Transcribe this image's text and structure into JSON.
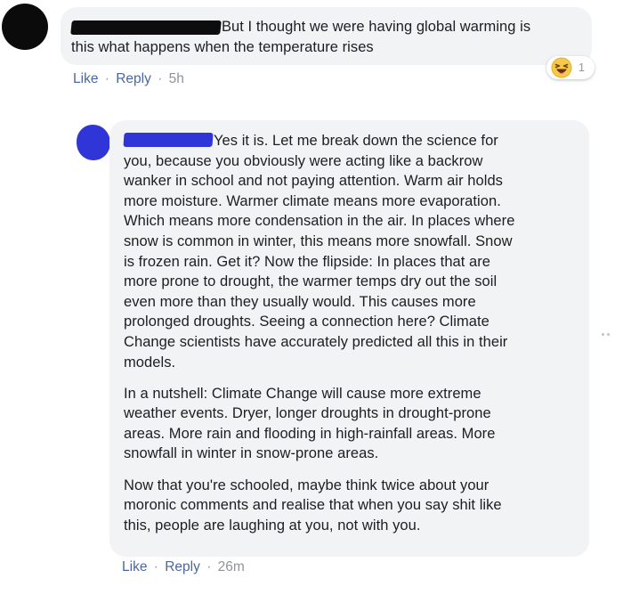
{
  "comment": {
    "text_lines": [
      "But I thought we were having global warming is",
      "this what happens when the temperature rises"
    ],
    "actions": {
      "like": "Like",
      "reply": "Reply",
      "separator": "·",
      "time": "5h"
    },
    "reaction": {
      "icon": "haha-emoji-icon",
      "count": "1"
    }
  },
  "reply": {
    "paragraphs": [
      [
        "Yes it is. Let me break down the science for",
        "you, because you obviously were acting like a backrow",
        "wanker in school and not paying attention. Warm air holds",
        "more moisture. Warmer climate means more evaporation.",
        "Which means more condensation in the air. In places where",
        "snow is common in winter, this means more snowfall. Snow",
        "is frozen rain. Get it? Now the flipside: In places that are",
        "more prone to drought, the warmer temps dry out the soil",
        "even more than they usually would. This causes more",
        "prolonged droughts. Seeing a connection here? Climate",
        "Change scientists have accurately predicted all this in their",
        "models."
      ],
      [
        "In a nutshell: Climate Change will cause more extreme",
        "weather events. Dryer, longer droughts in drought-prone",
        "areas. More rain and flooding in high-rainfall areas. More",
        "snowfall in winter in snow-prone areas."
      ],
      [
        "Now that you're schooled, maybe think twice about your",
        "moronic comments and realise that when you say shit like",
        "this, people are laughing at you, not with you."
      ]
    ],
    "actions": {
      "like": "Like",
      "reply": "Reply",
      "separator": "·",
      "time": "26m"
    }
  },
  "colors": {
    "bubble_background": "#f2f3f5",
    "link": "#4b67a1",
    "meta_text": "#90949c",
    "redaction_black": "#0d0d0d",
    "redaction_blue": "#2f35d6"
  }
}
